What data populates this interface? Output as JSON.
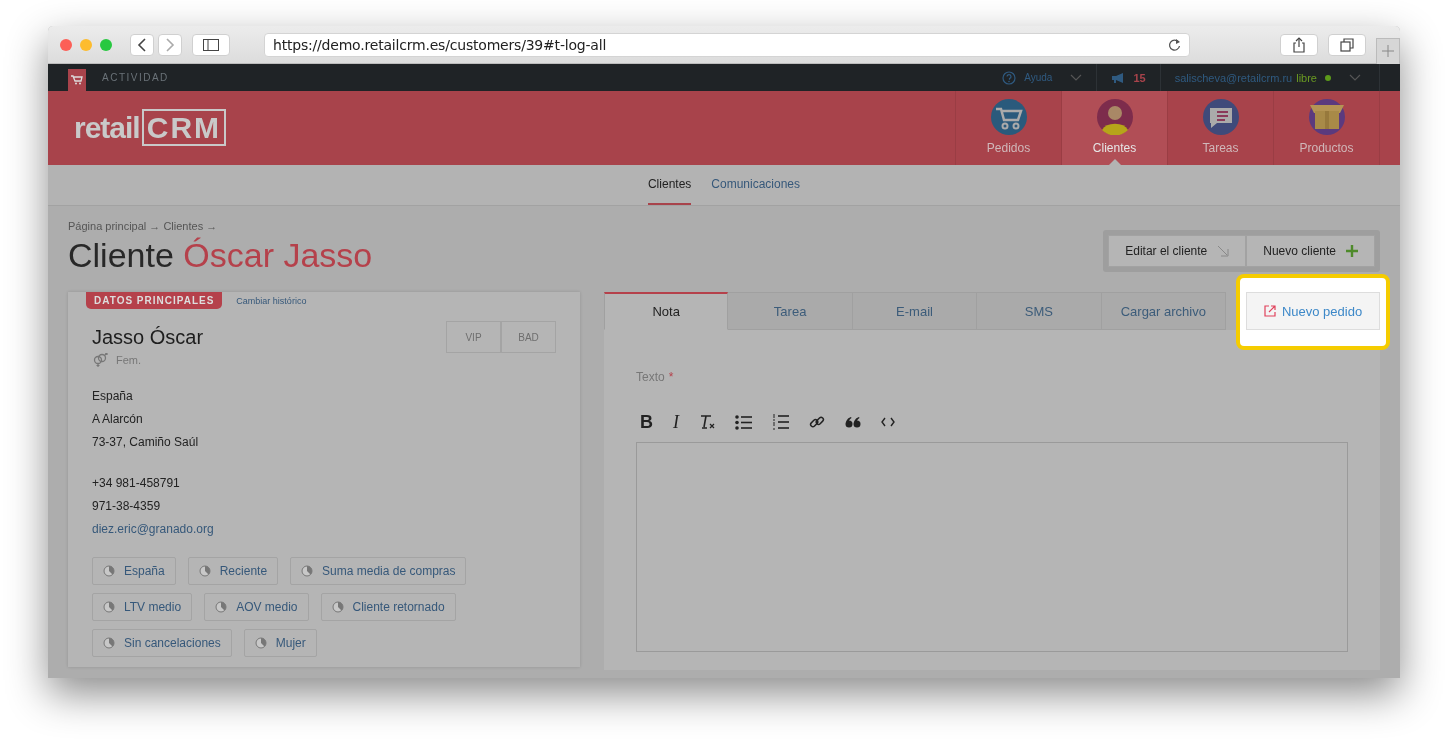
{
  "browser": {
    "url": "https://demo.retailcrm.es/customers/39#t-log-all"
  },
  "topbar": {
    "section": "ACTIVIDAD",
    "help": "Ayuda",
    "notifications": "15",
    "user": "salischeva@retailcrm.ru",
    "plan": "libre"
  },
  "header": {
    "logo": {
      "main": "retail",
      "accent": "CRM"
    },
    "nav": [
      {
        "label": "Pedidos",
        "kind": "cart",
        "selected": false
      },
      {
        "label": "Clientes",
        "kind": "person",
        "selected": true
      },
      {
        "label": "Tareas",
        "kind": "chat",
        "selected": false
      },
      {
        "label": "Productos",
        "kind": "box",
        "selected": false
      }
    ]
  },
  "subnav": [
    {
      "label": "Clientes",
      "selected": true
    },
    {
      "label": "Comunicaciones",
      "selected": false
    }
  ],
  "breadcrumb": "Página principal → Clientes →",
  "title": {
    "prefix": "Cliente",
    "name": "Óscar Jasso"
  },
  "actions": [
    {
      "label": "Editar el cliente",
      "kind": "edit"
    },
    {
      "label": "Nuevo cliente",
      "kind": "plus"
    }
  ],
  "customer_card": {
    "badge": "DATOS PRINCIPALES",
    "history_link": "Cambiar histórico",
    "name": "Jasso Óscar",
    "flags": [
      {
        "label": "VIP",
        "selected": false
      },
      {
        "label": "BAD",
        "selected": false
      }
    ],
    "gender": "Fem.",
    "address": [
      "España",
      "A Alarcón",
      "73-37, Camiño Saúl"
    ],
    "phones": [
      "+34 981-458791",
      "971-38-4359"
    ],
    "email": "diez.eric@granado.org",
    "segments": [
      "España",
      "Reciente",
      "Suma media de compras",
      "LTV medio",
      "AOV medio",
      "Cliente retornado",
      "Sin cancelaciones",
      "Mujer"
    ]
  },
  "composer": {
    "tabs": [
      {
        "label": "Nota",
        "kind": "tab",
        "selected": true,
        "highlighted": false
      },
      {
        "label": "Tarea",
        "kind": "tab",
        "selected": false,
        "highlighted": false
      },
      {
        "label": "E-mail",
        "kind": "tab",
        "selected": false,
        "highlighted": false
      },
      {
        "label": "SMS",
        "kind": "tab",
        "selected": false,
        "highlighted": false
      },
      {
        "label": "Cargar archivo",
        "kind": "tab",
        "selected": false,
        "highlighted": false
      },
      {
        "label": "Nuevo pedido",
        "kind": "action",
        "selected": false,
        "highlighted": true
      }
    ],
    "field_label": "Texto",
    "required_mark": "*",
    "toolbar": [
      {
        "kind": "bold",
        "label": "B"
      },
      {
        "kind": "italic",
        "label": "I"
      },
      {
        "kind": "clear"
      },
      {
        "kind": "bullets"
      },
      {
        "kind": "numbers"
      },
      {
        "kind": "link"
      },
      {
        "kind": "quote"
      },
      {
        "kind": "code"
      }
    ]
  }
}
